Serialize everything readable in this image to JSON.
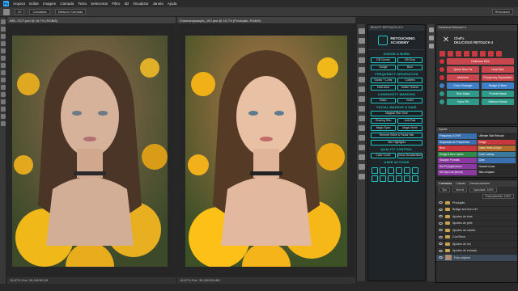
{
  "menubar": {
    "items": [
      "Arquivo",
      "Editar",
      "Imagem",
      "Camada",
      "Texto",
      "Selecionar",
      "Filtro",
      "3D",
      "Visualizar",
      "Janela",
      "Ajuda"
    ]
  },
  "options": {
    "brush_size": "20",
    "mode": "Camadas",
    "preset": "Misturar Camada",
    "workspace": "Retocador"
  },
  "docs": {
    "left_tab": "BRL-7577.psd @ 16,7% (RGB/8)",
    "left_status": "16,67%   Doc: 36,1M/36,1M",
    "right_tab": "Fotomanipulação_100.psd @ 16,7% (Produção, RGB/8)",
    "right_status": "16,67%   Doc: 36,1M/284,8M"
  },
  "beauty": {
    "header": "BEAUTY RETOUCH v2.3",
    "logo_line1": "RETOUCHING",
    "logo_line2": "ACADEMY",
    "sec_dodge": "DODGE & BURN",
    "dodge_rows": [
      [
        "DB Curves",
        "DB Grey"
      ],
      [
        "Dodge",
        "Burn"
      ]
    ],
    "sec_freq": "FREQUENCY SEPARATION",
    "freq_rows": [
      [
        "Gauss + Lunar",
        "Cuticles"
      ],
      [
        "Heal Area",
        "Soften Texture"
      ]
    ],
    "sec_lum": "LUMINOSITY MASKING",
    "lum_row": [
      "Basic",
      "Insert"
    ],
    "sec_makeup": "FACIAL MAKEUP & HAIR",
    "makeup_rows": [
      [
        "Magical Skin Tone"
      ],
      [
        "Glowing Skin",
        "Anti-Pale"
      ],
      [
        "Magic Eyes",
        "Magic Smile"
      ],
      [
        "Remove Shine & Facial Hair"
      ],
      [
        "Hair Highlights"
      ]
    ],
    "sec_quality": "QUALITY CONTROL",
    "quality_rows": [
      [
        "Color Curve",
        "Clean Desaturation"
      ]
    ],
    "sec_user": "USER ACTIONS"
  },
  "chef": {
    "header": "Delicious Retouch 4",
    "brand_line1": "Chef's",
    "brand_line2": "DELICIOUS RETOUCH 4",
    "rows": [
      {
        "label": "Delicious Skin",
        "color": "#c8464e"
      },
      {
        "label": "Quick Skin Fix",
        "color": "#c8464e"
      },
      {
        "label": "Moisture",
        "color": "#c8464e"
      },
      {
        "label": "Color Changer",
        "color": "#3f7fc8"
      },
      {
        "label": "Skin Mask",
        "color": "#2f9a8a"
      },
      {
        "label": "Eyes Fill",
        "color": "#2f9a8a"
      }
    ],
    "rows_right": [
      {
        "label": "Skin Tone Fix",
        "color": "#c8464e"
      },
      {
        "label": "Heal Skin",
        "color": "#c8464e"
      },
      {
        "label": "Frequency Separation",
        "color": "#c8464e"
      },
      {
        "label": "Dodge & Burn",
        "color": "#3f7fc8"
      },
      {
        "label": "Portrait Mask",
        "color": "#2f9a8a"
      },
      {
        "label": "Midtone Boost",
        "color": "#2f9a8a"
      }
    ]
  },
  "actions": {
    "header": "Ações",
    "items": [
      {
        "label": "Frequency 3.0 RR",
        "color": "#3a6fb0"
      },
      {
        "label": "Ultimate Skin Retouch",
        "color": "#2a2a2a"
      },
      {
        "label": "Separação de Frequência",
        "color": "#3a6fb0"
      },
      {
        "label": "Dodge",
        "color": "#c8383e"
      },
      {
        "label": "Burn",
        "color": "#c8383e"
      },
      {
        "label": "Clean Teeth & Eyes",
        "color": "#b06c2a"
      },
      {
        "label": "Dodge & Burn Ações",
        "color": "#2f8a4a"
      },
      {
        "label": "Color Lookup",
        "color": "#3a7a9a"
      },
      {
        "label": "Sharpen Portraits",
        "color": "#8a3aa0"
      },
      {
        "label": "Glow",
        "color": "#3a6fb0"
      },
      {
        "label": "Set Pt (Light) brush",
        "color": "#8a3aa0"
      },
      {
        "label": "Normal Lucas",
        "color": "#2a2a2a"
      },
      {
        "label": "Set Ops Lab (brush)",
        "color": "#8a3aa0"
      },
      {
        "label": "Skin compact",
        "color": "#2a2a2a"
      }
    ]
  },
  "layers": {
    "tabs": [
      "Camadas",
      "Canais",
      "Demarcadores"
    ],
    "kind": "Tipo",
    "blend": "Normal",
    "opacity": "Opacidade: 100%",
    "fill": "Preenchimento: 100%",
    "items": [
      {
        "name": "Produção",
        "type": "folder"
      },
      {
        "name": "Bridge and burn ref",
        "type": "folder"
      },
      {
        "name": "Ajustes de tone",
        "type": "folder"
      },
      {
        "name": "Ajustes de pele",
        "type": "folder"
      },
      {
        "name": "Ajustes de cabelo",
        "type": "folder"
      },
      {
        "name": "Cor/Olhos",
        "type": "folder"
      },
      {
        "name": "Ajustes de cor",
        "type": "folder"
      },
      {
        "name": "Ajustes de entrada",
        "type": "folder"
      },
      {
        "name": "Foto original",
        "type": "image"
      }
    ]
  }
}
